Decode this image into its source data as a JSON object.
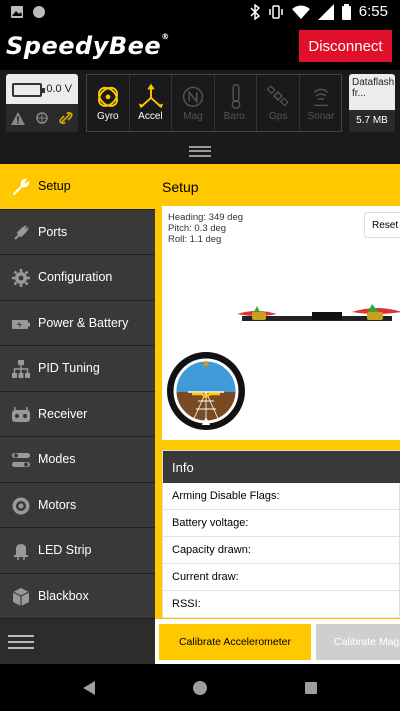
{
  "status_bar": {
    "time": "6:55",
    "left_icons": [
      "image-icon",
      "circle-icon"
    ],
    "right_icons": [
      "bluetooth-icon",
      "vibrate-icon",
      "wifi-icon",
      "signal-icon",
      "battery-icon"
    ]
  },
  "header": {
    "logo_text": "SpeedyBee",
    "disconnect_label": "Disconnect",
    "disconnect_color": "#e0102a"
  },
  "battery": {
    "voltage": "0.0 V",
    "icons": [
      "warning-icon",
      "gps-icon",
      "link-icon"
    ]
  },
  "sensors": [
    {
      "label": "Gyro",
      "icon": "gyro-icon",
      "active": true
    },
    {
      "label": "Accel",
      "icon": "accel-icon",
      "active": true
    },
    {
      "label": "Mag",
      "icon": "mag-icon",
      "active": false
    },
    {
      "label": "Baro.",
      "icon": "baro-icon",
      "active": false
    },
    {
      "label": "Gps",
      "icon": "gps-icon",
      "active": false
    },
    {
      "label": "Sonar",
      "icon": "sonar-icon",
      "active": false
    }
  ],
  "dataflash": {
    "title": "Dataflash fr...",
    "size": "5.7 MB"
  },
  "sidebar": {
    "items": [
      {
        "label": "Setup",
        "icon": "wrench-icon",
        "active": true
      },
      {
        "label": "Ports",
        "icon": "plug-icon",
        "active": false
      },
      {
        "label": "Configuration",
        "icon": "gear-icon",
        "active": false
      },
      {
        "label": "Power & Battery",
        "icon": "battery-icon",
        "active": false
      },
      {
        "label": "PID Tuning",
        "icon": "pid-icon",
        "active": false
      },
      {
        "label": "Receiver",
        "icon": "receiver-icon",
        "active": false
      },
      {
        "label": "Modes",
        "icon": "modes-icon",
        "active": false
      },
      {
        "label": "Motors",
        "icon": "motor-icon",
        "active": false
      },
      {
        "label": "LED Strip",
        "icon": "led-icon",
        "active": false
      },
      {
        "label": "Blackbox",
        "icon": "blackbox-icon",
        "active": false
      }
    ]
  },
  "main": {
    "title": "Setup",
    "heading": "Heading: 349 deg",
    "pitch": "Pitch: 0.3 deg",
    "roll": "Roll: 1.1 deg",
    "reset_label": "Reset Z",
    "info": {
      "title": "Info",
      "rows": [
        "Arming Disable Flags:",
        "Battery voltage:",
        "Capacity drawn:",
        "Current draw:",
        "RSSI:"
      ]
    },
    "calibrate_accel_label": "Calibrate Accelerometer",
    "calibrate_mag_label": "Calibrate Mag",
    "accent_color": "#ffc800"
  },
  "navbar": {
    "icons": [
      "back-icon",
      "home-icon",
      "recents-icon"
    ]
  }
}
